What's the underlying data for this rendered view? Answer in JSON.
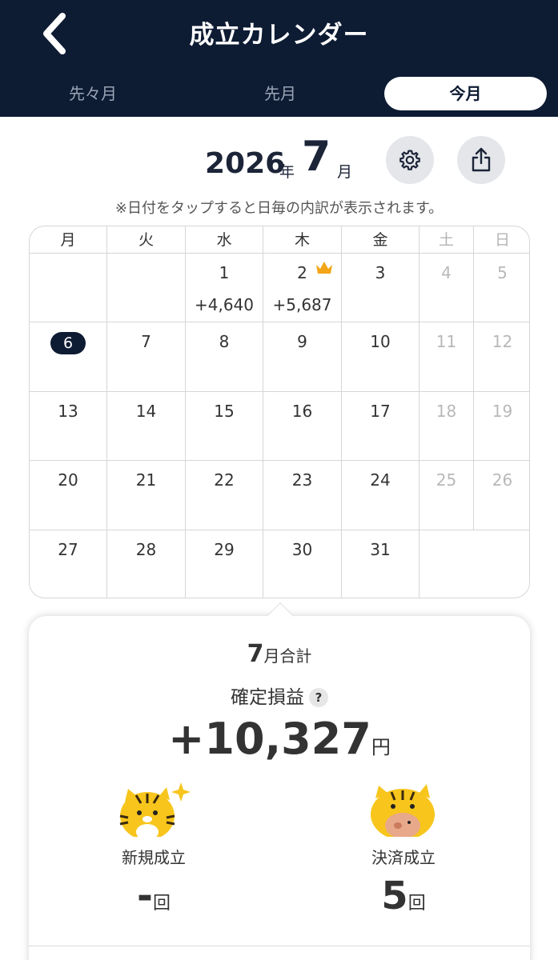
{
  "header": {
    "title": "成立カレンダー",
    "tabs": [
      "先々月",
      "先月",
      "今月"
    ]
  },
  "month": {
    "year": "2026",
    "year_unit": "年",
    "month": "7",
    "month_unit": "月"
  },
  "note": "※日付をタップすると日毎の内訳が表示されます。",
  "calendar": {
    "weekdays": [
      "月",
      "火",
      "水",
      "木",
      "金",
      "土",
      "日"
    ],
    "weeks": [
      [
        {
          "day": ""
        },
        {
          "day": ""
        },
        {
          "day": "1",
          "pl": "+4,640"
        },
        {
          "day": "2",
          "pl": "+5,687",
          "crown": true
        },
        {
          "day": "3"
        },
        {
          "day": "4"
        },
        {
          "day": "5"
        }
      ],
      [
        {
          "day": "6",
          "today": true
        },
        {
          "day": "7"
        },
        {
          "day": "8"
        },
        {
          "day": "9"
        },
        {
          "day": "10"
        },
        {
          "day": "11"
        },
        {
          "day": "12"
        }
      ],
      [
        {
          "day": "13"
        },
        {
          "day": "14"
        },
        {
          "day": "15"
        },
        {
          "day": "16"
        },
        {
          "day": "17"
        },
        {
          "day": "18"
        },
        {
          "day": "19"
        }
      ],
      [
        {
          "day": "20"
        },
        {
          "day": "21"
        },
        {
          "day": "22"
        },
        {
          "day": "23"
        },
        {
          "day": "24"
        },
        {
          "day": "25"
        },
        {
          "day": "26"
        }
      ],
      [
        {
          "day": "27"
        },
        {
          "day": "28"
        },
        {
          "day": "29"
        },
        {
          "day": "30"
        },
        {
          "day": "31"
        },
        {
          "day": ""
        },
        {
          "day": ""
        }
      ]
    ]
  },
  "summary": {
    "month": "7",
    "month_suffix": "月合計",
    "pl_label": "確定損益",
    "help": "?",
    "pl_value": "+10,327",
    "pl_unit": "円",
    "new_label": "新規成立",
    "new_value": "-",
    "close_label": "決済成立",
    "close_value": "5",
    "count_unit": "回"
  },
  "colors": {
    "header_bg": "#0d1b33",
    "crown": "#f2a516",
    "mascot": "#f7c51c"
  }
}
